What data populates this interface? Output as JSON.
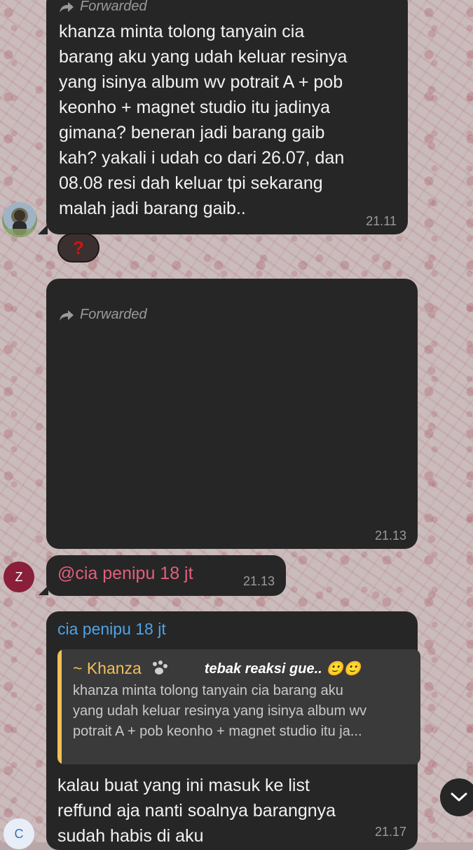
{
  "messages": {
    "m1": {
      "forwarded_label": "Forwarded",
      "text_lines": [
        "khanza minta tolong tanyain cia",
        "barang aku yang udah keluar resinya",
        "yang isinya album wv potrait A + pob",
        "keonho + magnet studio itu jadinya",
        "gimana? beneran jadi barang gaib",
        "kah? yakali i udah co dari 26.07, dan",
        "08.08 resi dah keluar tpi sekarang",
        "malah jadi barang gaib.."
      ],
      "time": "21.11",
      "reaction": "?"
    },
    "m2": {
      "forwarded_label": "Forwarded",
      "time": "21.13"
    },
    "m3": {
      "avatar_letter": "Z",
      "mention": "@cia penipu 18 jt",
      "time": "21.13"
    },
    "m4": {
      "sender": "cia penipu 18 jt",
      "reply_name": "~ Khanza",
      "story_caption": "tebak reaksi gue.. 🙂🙂",
      "reply_lines": [
        "khanza minta tolong tanyain cia barang aku",
        "yang udah keluar resinya yang isinya album wv",
        "potrait A + pob keonho + magnet studio itu ja..."
      ],
      "text_lines": [
        "kalau buat yang ini masuk ke list",
        "reffund aja nanti soalnya barangnya",
        "sudah habis di aku"
      ],
      "time": "21.17",
      "avatar_letter": "C"
    }
  },
  "colors": {
    "bubble": "#262626",
    "mention": "#e0607a",
    "sender": "#4fa3e6",
    "reply_bar": "#f0c05a",
    "avatar_z": "#8a1f3a",
    "avatar_c": "#e8eef7"
  },
  "icons": {
    "forward": "forward-arrow-icon",
    "scroll_down": "chevron-down-icon",
    "reaction": "question-mark-icon",
    "paw": "paw-icon"
  }
}
